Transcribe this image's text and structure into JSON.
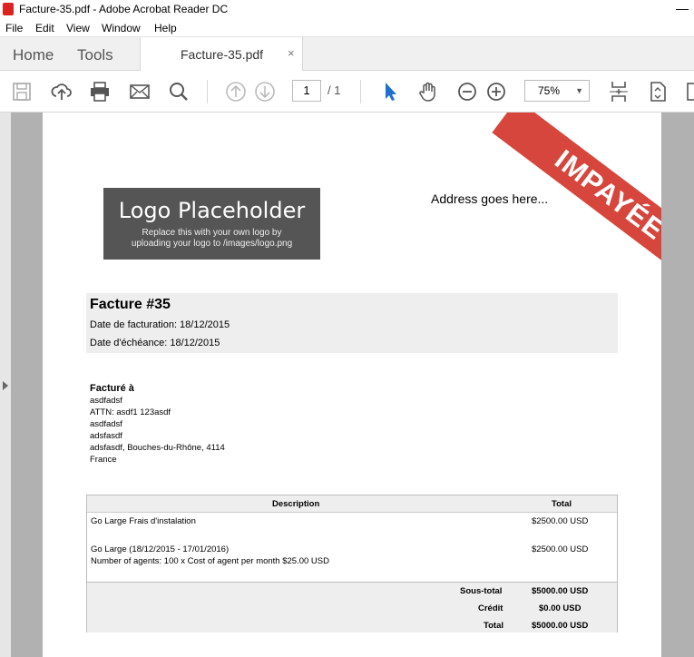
{
  "window": {
    "title": "Facture-35.pdf - Adobe Acrobat Reader DC",
    "minimize_glyph": "—"
  },
  "menu": [
    "File",
    "Edit",
    "View",
    "Window",
    "Help"
  ],
  "nav_tabs": {
    "home": "Home",
    "tools": "Tools"
  },
  "doc_tab": {
    "label": "Facture-35.pdf",
    "close": "×"
  },
  "toolbar": {
    "icons": [
      "save-icon",
      "upload-icon",
      "print-icon",
      "mail-icon",
      "search-icon",
      "page-up-icon",
      "page-down-icon",
      "select-arrow-icon",
      "hand-icon",
      "zoom-out-icon",
      "zoom-in-icon",
      "fit-page-icon",
      "page-tools-icon",
      "more-icon"
    ],
    "page_current": "1",
    "page_total": "/ 1",
    "zoom": "75%",
    "accent": "#1e6fcf"
  },
  "stamp": {
    "text": "IMPAYÉE",
    "color": "#d7463c"
  },
  "logo": {
    "title": "Logo Placeholder",
    "line1": "Replace this with your own logo by",
    "line2": "uploading your logo to /images/logo.png"
  },
  "address": "Address goes here...",
  "invoice": {
    "title": "Facture #35",
    "date_label": "Date de facturation: 18/12/2015",
    "due_label": "Date d'échéance: 18/12/2015"
  },
  "billed_to": {
    "title": "Facturé à",
    "lines": [
      "asdfadsf",
      "ATTN: asdf1 123asdf",
      "asdfadsf",
      "adsfasdf",
      "adsfasdf, Bouches-du-Rhône, 4114",
      "France"
    ]
  },
  "table": {
    "headers": {
      "description": "Description",
      "total": "Total"
    },
    "rows": [
      {
        "desc1": "Go Large Frais d'instalation",
        "desc2": "",
        "amount": "$2500.00 USD"
      },
      {
        "desc1": "Go Large (18/12/2015 - 17/01/2016)",
        "desc2": "Number of agents: 100 x Cost of agent per month $25.00 USD",
        "amount": "$2500.00 USD"
      }
    ],
    "totals": [
      {
        "label": "Sous-total",
        "value": "$5000.00 USD"
      },
      {
        "label": "Crédit",
        "value": "$0.00 USD"
      },
      {
        "label": "Total",
        "value": "$5000.00 USD"
      }
    ]
  }
}
